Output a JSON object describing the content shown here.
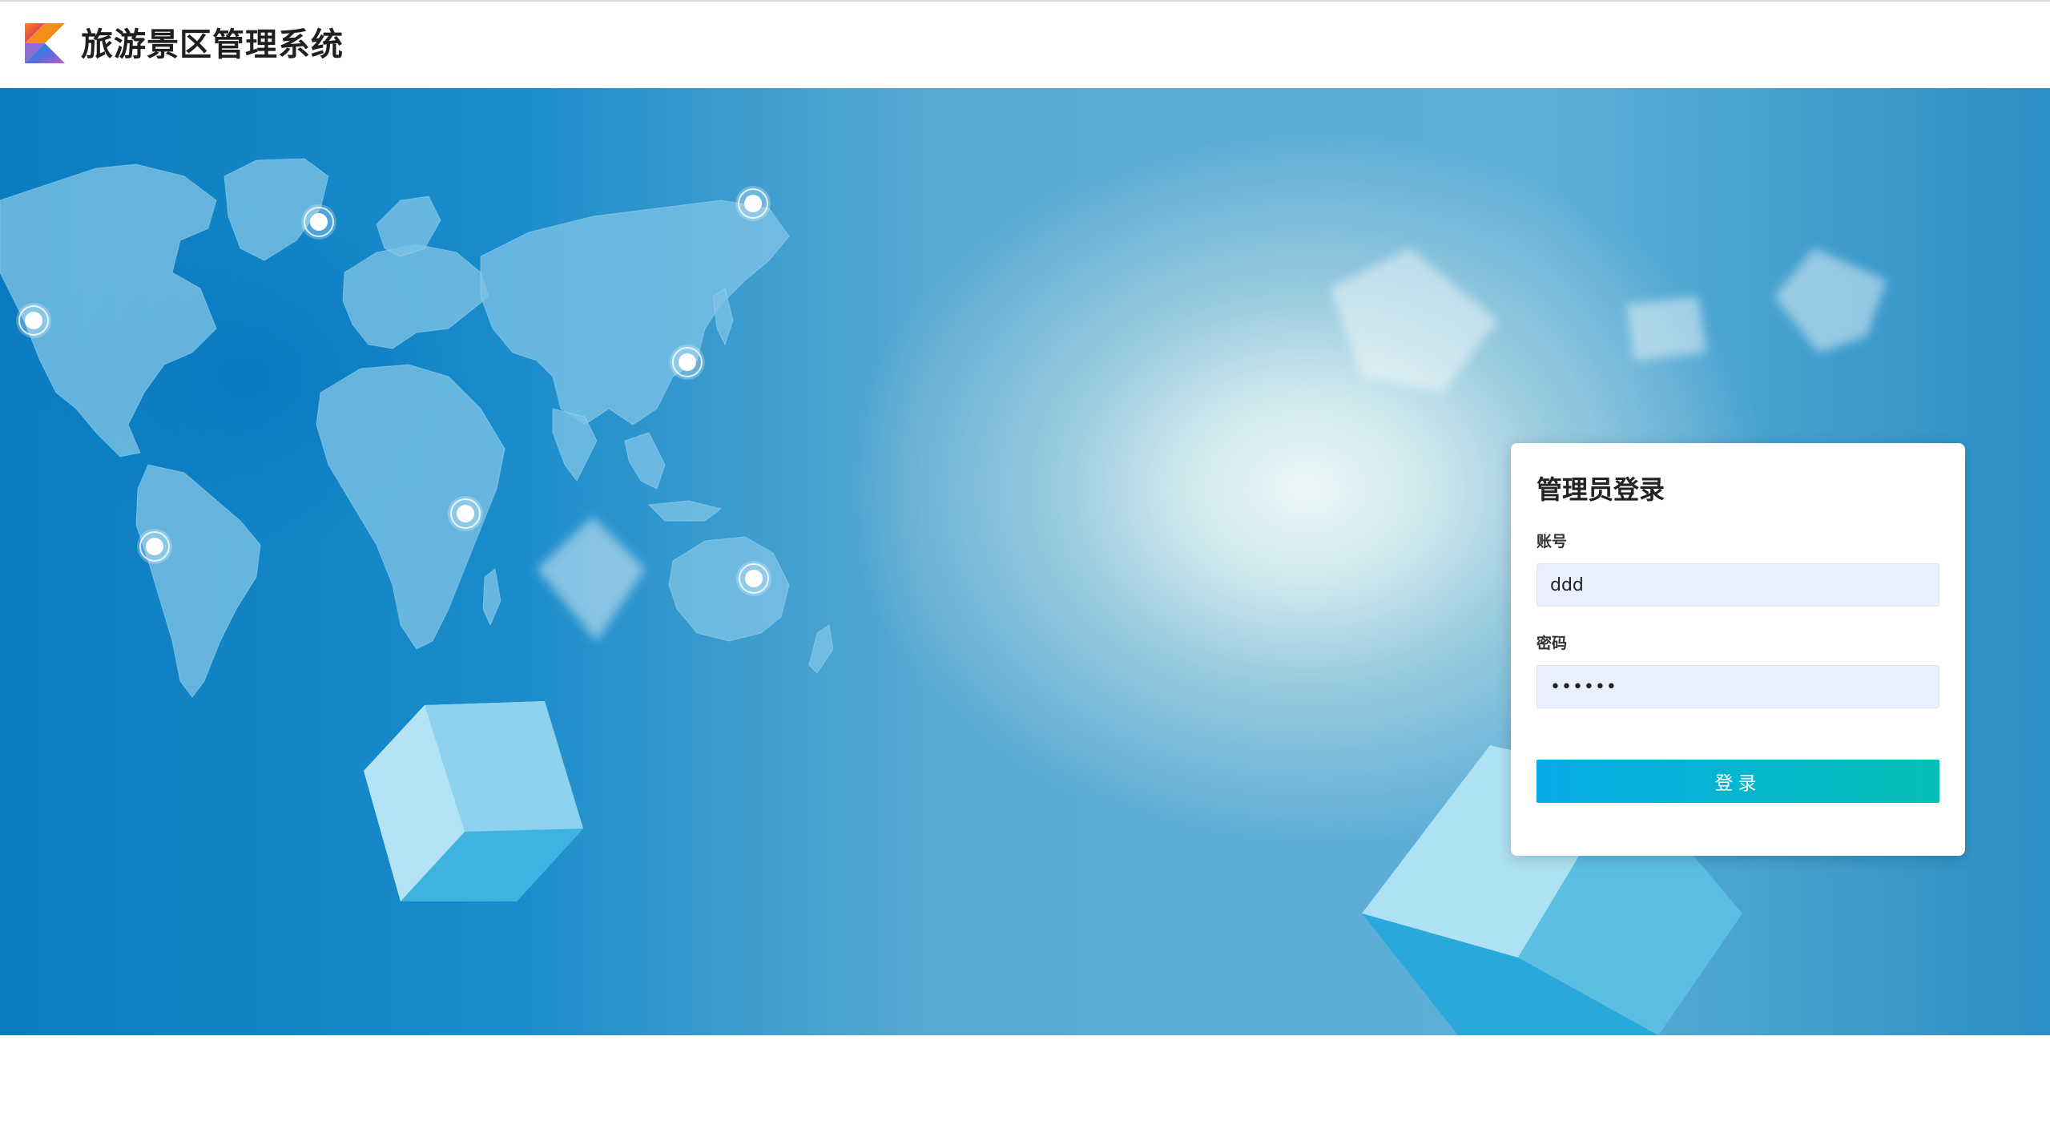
{
  "header": {
    "title": "旅游景区管理系统",
    "logo_icon": "kotlin-logo-icon"
  },
  "login": {
    "title": "管理员登录",
    "account_label": "账号",
    "account_value": "ddd",
    "password_label": "密码",
    "password_value": "dddddd",
    "submit_label": "登录"
  },
  "colors": {
    "button_gradient_start": "#05abe8",
    "button_gradient_end": "#05c0b6",
    "input_bg": "#e8f0fe",
    "hero_blue": "#0b7cc0"
  }
}
